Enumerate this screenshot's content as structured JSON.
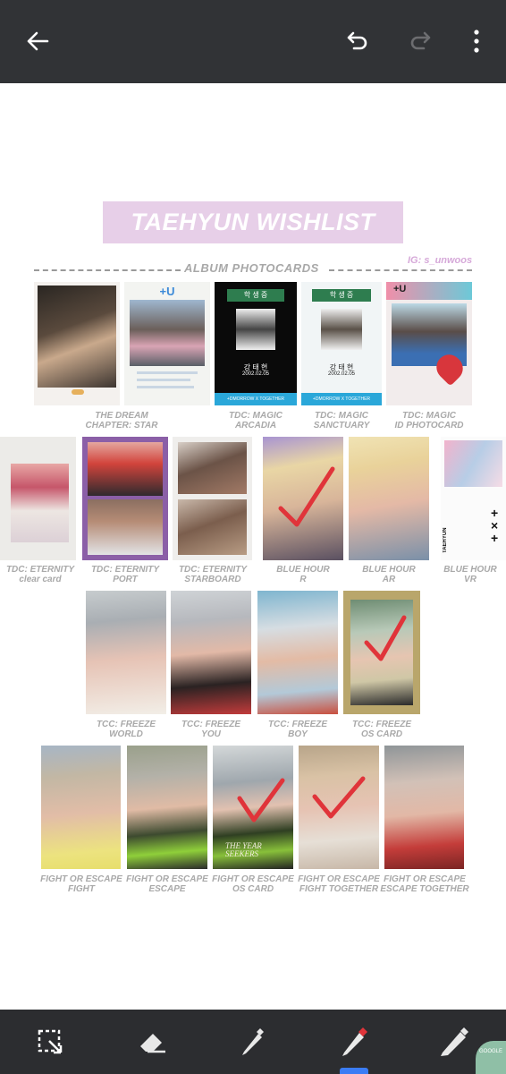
{
  "toolbar": {
    "back_icon": "arrow-left-icon",
    "undo_icon": "undo-icon",
    "redo_icon": "redo-icon",
    "menu_icon": "more-vertical-icon"
  },
  "document": {
    "title": "TAEHYUN WISHLIST",
    "section": "ALBUM PHOTOCARDS",
    "ig_handle": "IG: s_unwoos",
    "rows": [
      [
        {
          "line1": "THE DREAM",
          "line2": "CHAPTER: STAR"
        },
        {
          "line1": "TDC: MAGIC",
          "line2": "ARCADIA"
        },
        {
          "line1": "TDC: MAGIC",
          "line2": "SANCTUARY"
        },
        {
          "line1": "TDC: MAGIC",
          "line2": "ID PHOTOCARD"
        }
      ],
      [
        {
          "line1": "TDC: ETERNITY",
          "line2": "clear card"
        },
        {
          "line1": "TDC: ETERNITY",
          "line2": "PORT"
        },
        {
          "line1": "TDC: ETERNITY",
          "line2": "STARBOARD"
        },
        {
          "line1": "BLUE HOUR",
          "line2": "R"
        },
        {
          "line1": "BLUE HOUR",
          "line2": "AR"
        },
        {
          "line1": "BLUE HOUR",
          "line2": "VR"
        }
      ],
      [
        {
          "line1": "TCC: FREEZE",
          "line2": "WORLD"
        },
        {
          "line1": "TCC: FREEZE",
          "line2": "YOU"
        },
        {
          "line1": "TCC: FREEZE",
          "line2": "BOY"
        },
        {
          "line1": "TCC: FREEZE",
          "line2": "OS CARD"
        }
      ],
      [
        {
          "line1": "FIGHT OR ESCAPE",
          "line2": "FIGHT"
        },
        {
          "line1": "FIGHT OR ESCAPE",
          "line2": "ESCAPE"
        },
        {
          "line1": "FIGHT OR ESCAPE",
          "line2": "OS CARD"
        },
        {
          "line1": "FIGHT OR ESCAPE",
          "line2": "FIGHT TOGETHER"
        },
        {
          "line1": "FIGHT OR ESCAPE",
          "line2": "ESCAPE TOGETHER"
        }
      ]
    ],
    "card_text": {
      "plus_u": "+U",
      "student_label": "학 생 증",
      "name": "강 태 현",
      "date": "2002.02.05",
      "footer": "+DMORROW X TOGETHER",
      "card_name": "TAEHYUN",
      "album_text": "THE YEAR SEEKERS"
    }
  },
  "bottom_tools": {
    "select_icon": "selection-icon",
    "eraser_icon": "eraser-icon",
    "pen_icon": "pen-icon",
    "marker_icon": "marker-icon",
    "highlighter_icon": "highlighter-icon",
    "badge_text": "GOOGLE"
  },
  "colors": {
    "toolbar_bg": "#313336",
    "title_bg": "#e7cfe8",
    "check_mark": "#e0343a",
    "active_tool": "#3b7cf5"
  }
}
